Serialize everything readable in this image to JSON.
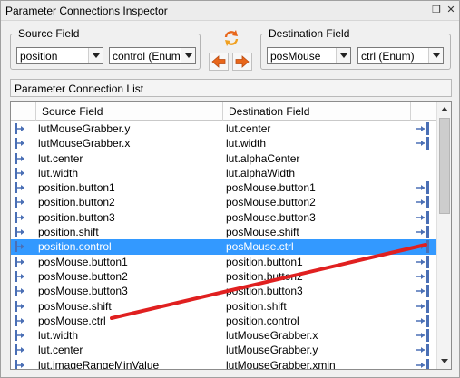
{
  "window": {
    "title": "Parameter Connections Inspector",
    "restore_icon": "restore-icon",
    "close_icon": "close-icon",
    "restore_glyph": "❐",
    "close_glyph": "✕"
  },
  "source": {
    "legend": "Source Field",
    "field_value": "position",
    "type_value": "control (Enum)"
  },
  "destination": {
    "legend": "Destination Field",
    "field_value": "posMouse",
    "type_value": "ctrl (Enum)"
  },
  "toolbar": {
    "swap_icon": "swap-arrows-icon",
    "arrow_left_icon": "arrow-left-icon",
    "arrow_right_icon": "arrow-right-icon"
  },
  "list": {
    "title": "Parameter Connection List",
    "columns": [
      "Source Field",
      "Destination Field"
    ],
    "selected_index": 8,
    "rows": [
      {
        "src": "lutMouseGrabber.y",
        "dst": "lut.center",
        "lp": true,
        "rp": true
      },
      {
        "src": "lutMouseGrabber.x",
        "dst": "lut.width",
        "lp": true,
        "rp": true
      },
      {
        "src": "lut.center",
        "dst": "lut.alphaCenter",
        "lp": true,
        "rp": false
      },
      {
        "src": "lut.width",
        "dst": "lut.alphaWidth",
        "lp": true,
        "rp": false
      },
      {
        "src": "position.button1",
        "dst": "posMouse.button1",
        "lp": true,
        "rp": true
      },
      {
        "src": "position.button2",
        "dst": "posMouse.button2",
        "lp": true,
        "rp": true
      },
      {
        "src": "position.button3",
        "dst": "posMouse.button3",
        "lp": true,
        "rp": true
      },
      {
        "src": "position.shift",
        "dst": "posMouse.shift",
        "lp": true,
        "rp": true
      },
      {
        "src": "position.control",
        "dst": "posMouse.ctrl",
        "lp": true,
        "rp": true
      },
      {
        "src": "posMouse.button1",
        "dst": "position.button1",
        "lp": true,
        "rp": true
      },
      {
        "src": "posMouse.button2",
        "dst": "position.button2",
        "lp": true,
        "rp": true
      },
      {
        "src": "posMouse.button3",
        "dst": "position.button3",
        "lp": true,
        "rp": true
      },
      {
        "src": "posMouse.shift",
        "dst": "position.shift",
        "lp": true,
        "rp": true
      },
      {
        "src": "posMouse.ctrl",
        "dst": "position.control",
        "lp": true,
        "rp": true
      },
      {
        "src": "lut.width",
        "dst": "lutMouseGrabber.x",
        "lp": true,
        "rp": true
      },
      {
        "src": "lut.center",
        "dst": "lutMouseGrabber.y",
        "lp": true,
        "rp": true
      },
      {
        "src": "lut.imageRangeMinValue",
        "dst": "lutMouseGrabber.xmin",
        "lp": true,
        "rp": true
      }
    ]
  },
  "colors": {
    "selection": "#3399ff",
    "port_blue": "#4a6fb5",
    "annotation_red": "#e02020",
    "arrow_orange": "#e8661a"
  }
}
